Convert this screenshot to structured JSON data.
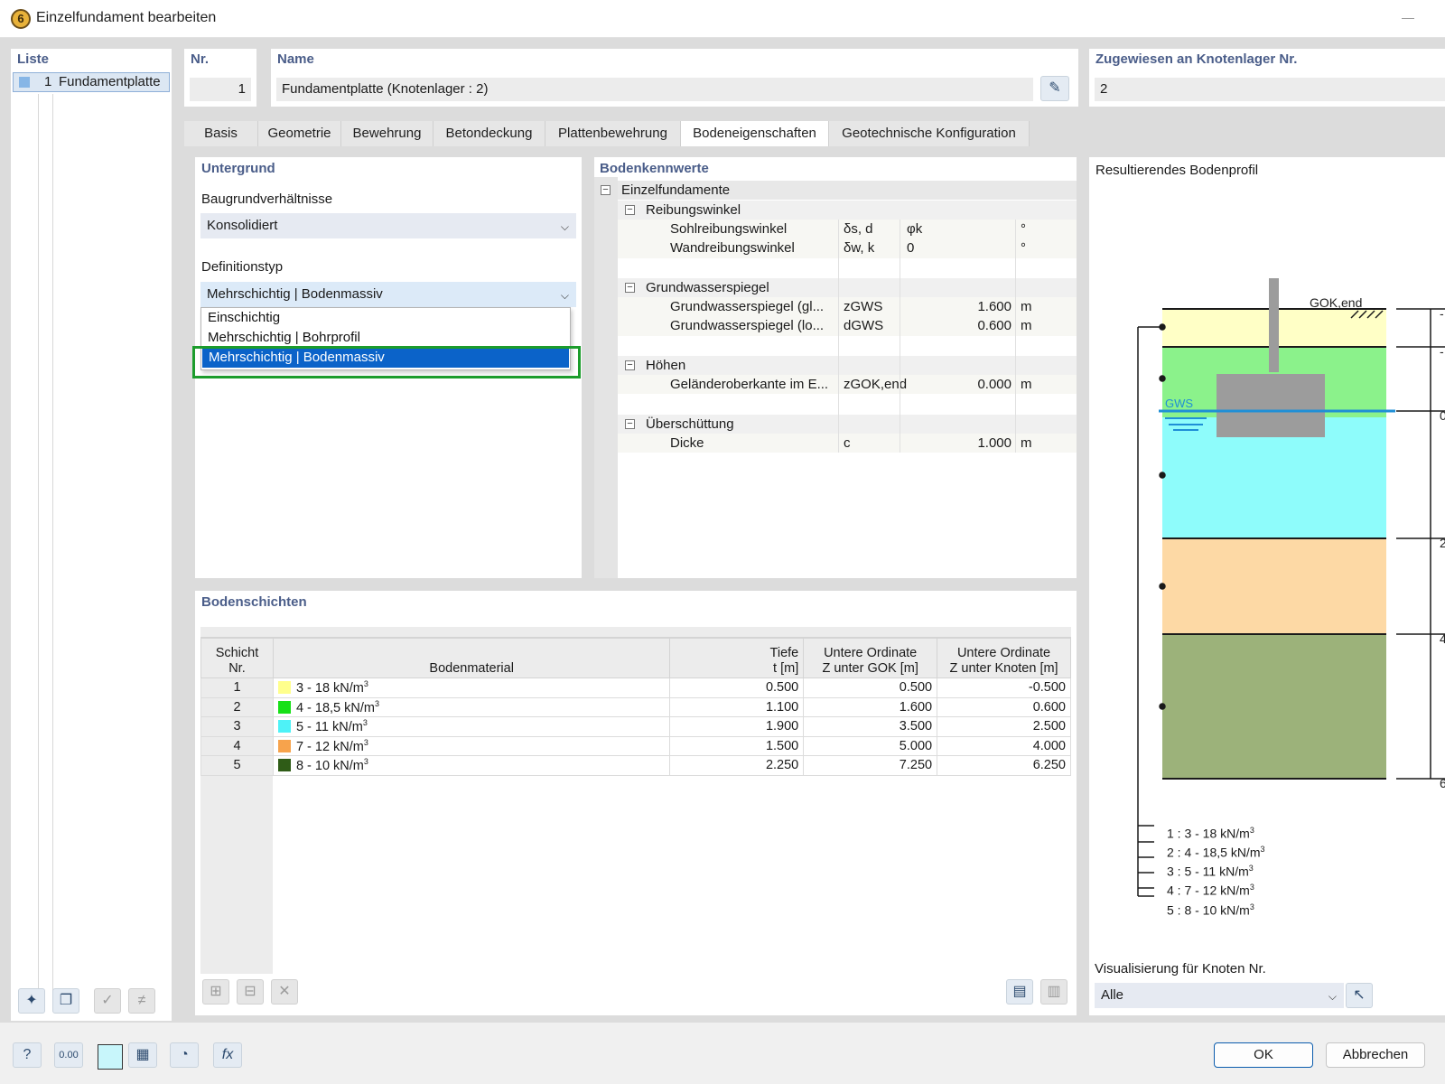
{
  "window": {
    "title": "Einzelfundament bearbeiten"
  },
  "list": {
    "header": "Liste",
    "items": [
      {
        "no": "1",
        "label": "Fundamentplatte"
      }
    ]
  },
  "nr": {
    "label": "Nr.",
    "value": "1"
  },
  "name": {
    "label": "Name",
    "value": "Fundamentplatte (Knotenlager : 2)"
  },
  "assigned": {
    "label": "Zugewiesen an Knotenlager Nr.",
    "value": "2"
  },
  "tabs": [
    "Basis",
    "Geometrie",
    "Bewehrung",
    "Betondeckung",
    "Plattenbewehrung",
    "Bodeneigenschaften",
    "Geotechnische Konfiguration"
  ],
  "untergrund": {
    "header": "Untergrund",
    "baugrund_label": "Baugrundverhältnisse",
    "baugrund_value": "Konsolidiert",
    "deftyp_label": "Definitionstyp",
    "deftyp_value": "Mehrschichtig | Bodenmassiv",
    "options": [
      "Einschichtig",
      "Mehrschichtig | Bohrprofil",
      "Mehrschichtig | Bodenmassiv"
    ]
  },
  "kennwerte": {
    "header": "Bodenkennwerte",
    "root": "Einzelfundamente",
    "groups": [
      {
        "label": "Reibungswinkel",
        "rows": [
          {
            "name": "Sohlreibungswinkel",
            "sym": "δs, d",
            "value": "φk",
            "unit": "°"
          },
          {
            "name": "Wandreibungswinkel",
            "sym": "δw, k",
            "value": "0",
            "unit": "°"
          }
        ]
      },
      {
        "label": "Grundwasserspiegel",
        "rows": [
          {
            "name": "Grundwasserspiegel (gl...",
            "sym": "zGWS",
            "value": "1.600",
            "unit": "m"
          },
          {
            "name": "Grundwasserspiegel (lo...",
            "sym": "dGWS",
            "value": "0.600",
            "unit": "m"
          }
        ]
      },
      {
        "label": "Höhen",
        "rows": [
          {
            "name": "Geländeroberkante im E...",
            "sym": "zGOK,end",
            "value": "0.000",
            "unit": "m"
          }
        ]
      },
      {
        "label": "Überschüttung",
        "rows": [
          {
            "name": "Dicke",
            "sym": "c",
            "value": "1.000",
            "unit": "m"
          }
        ]
      }
    ]
  },
  "schichten": {
    "header": "Bodenschichten",
    "col_headers": {
      "nr1": "Schicht",
      "nr2": "Nr.",
      "mat": "Bodenmaterial",
      "tiefe1": "Tiefe",
      "tiefe2": "t [m]",
      "gok1": "Untere Ordinate",
      "gok2": "Z unter GOK [m]",
      "kn1": "Untere Ordinate",
      "kn2": "Z unter Knoten [m]"
    },
    "rows": [
      {
        "no": "1",
        "mat": "3 - 18 kN/m",
        "color": "#ffff8c",
        "t": "0.500",
        "gok": "0.500",
        "kn": "-0.500"
      },
      {
        "no": "2",
        "mat": "4 - 18,5 kN/m",
        "color": "#17e017",
        "t": "1.100",
        "gok": "1.600",
        "kn": "0.600"
      },
      {
        "no": "3",
        "mat": "5 - 11 kN/m",
        "color": "#4ef2f7",
        "t": "1.900",
        "gok": "3.500",
        "kn": "2.500"
      },
      {
        "no": "4",
        "mat": "7 - 12 kN/m",
        "color": "#f7a34c",
        "t": "1.500",
        "gok": "5.000",
        "kn": "4.000"
      },
      {
        "no": "5",
        "mat": "8 - 10 kN/m",
        "color": "#2f5c17",
        "t": "2.250",
        "gok": "7.250",
        "kn": "6.250"
      }
    ]
  },
  "profil": {
    "header": "Resultierendes Bodenprofil",
    "gok_label": "GOK,end",
    "gws_label": "GWS",
    "axis_labels": [
      "-",
      "-",
      "0",
      "2",
      "4",
      "6"
    ],
    "legend": [
      "1 :  3 - 18 kN/m",
      "2 :  4 - 18,5 kN/m",
      "3 :  5 - 11 kN/m",
      "4 :  7 - 12 kN/m",
      "5 :  8 - 10 kN/m"
    ],
    "layer_colors": [
      "#ffffc6",
      "#8bf28b",
      "#8efcfb",
      "#fdd9a5",
      "#9cb27a"
    ]
  },
  "visualisierung": {
    "label": "Visualisierung für Knoten Nr.",
    "value": "Alle"
  },
  "buttons": {
    "ok": "OK",
    "cancel": "Abbrechen"
  },
  "bottom_icons": [
    "help-icon",
    "units-icon",
    "color-icon",
    "display-icon",
    "view-icon",
    "formula-icon"
  ]
}
